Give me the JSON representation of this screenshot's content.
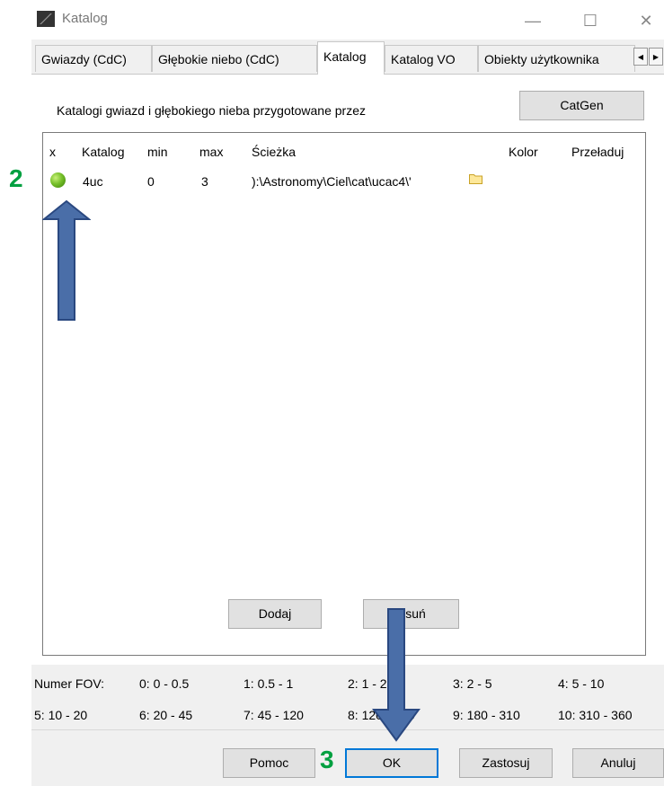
{
  "window": {
    "title": "Katalog",
    "controls": {
      "minimize": "—",
      "maximize": "☐",
      "close": "✕"
    }
  },
  "tabs": [
    {
      "label": "Gwiazdy (CdC)",
      "active": false
    },
    {
      "label": "Głębokie niebo (CdC)",
      "active": false
    },
    {
      "label": "Katalog",
      "active": true
    },
    {
      "label": "Katalog VO",
      "active": false
    },
    {
      "label": "Obiekty użytkownika",
      "active": false
    }
  ],
  "tab_scroll": {
    "left": "◀",
    "right": "▶"
  },
  "intro_text": "Katalogi gwiazd i głębokiego nieba przygotowane przez",
  "catgen_button": "CatGen",
  "grid": {
    "headers": {
      "x": "x",
      "katalog": "Katalog",
      "min": "min",
      "max": "max",
      "sciezka": "Ścieżka",
      "kolor": "Kolor",
      "przeladuj": "Przeładuj"
    },
    "rows": [
      {
        "katalog": "4uc",
        "min": "0",
        "max": "3",
        "sciezka": "):\\Astronomy\\Ciel\\cat\\ucac4\\'",
        "enabled_color": "#76c02a"
      }
    ]
  },
  "buttons": {
    "dodaj": "Dodaj",
    "usun": "Usuń",
    "pomoc": "Pomoc",
    "ok": "OK",
    "zastosuj": "Zastosuj",
    "anuluj": "Anuluj"
  },
  "fov": {
    "label": "Numer FOV:",
    "row1": [
      "0: 0 - 0.5",
      "1: 0.5 - 1",
      "2: 1 - 2",
      "3: 2 - 5",
      "4: 5 - 10"
    ],
    "row2": [
      "5: 10 - 20",
      "6: 20 - 45",
      "7: 45 - 120",
      "8: 120 - 180",
      "9: 180 - 310",
      "10: 310 - 360"
    ]
  },
  "annotations": {
    "step2": "2",
    "step3": "3",
    "arrow_color": "#4a6ea8",
    "step_color": "#00a040"
  }
}
